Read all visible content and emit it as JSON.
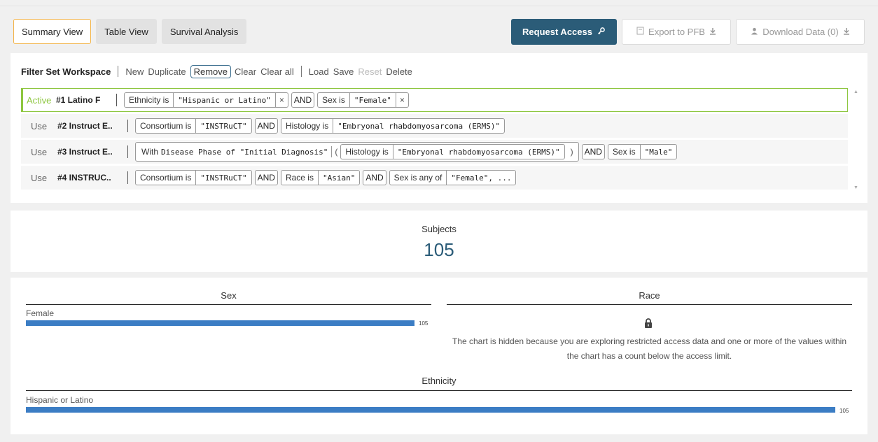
{
  "tabs": [
    {
      "label": "Summary View",
      "active": true
    },
    {
      "label": "Table View",
      "active": false
    },
    {
      "label": "Survival Analysis",
      "active": false
    }
  ],
  "actions": {
    "request_access": "Request Access",
    "export": "Export to PFB",
    "download": "Download Data (0)"
  },
  "workspace": {
    "title": "Filter Set Workspace",
    "links": [
      "New",
      "Duplicate",
      "Remove",
      "Clear",
      "Clear all",
      "Load",
      "Save",
      "Reset",
      "Delete"
    ],
    "filter_sets": [
      {
        "status": "Active",
        "name": "#1 Latino F"
      },
      {
        "status": "Use",
        "name": "#2 Instruct E.."
      },
      {
        "status": "Use",
        "name": "#3 Instruct E.."
      },
      {
        "status": "Use",
        "name": "#4 INSTRUC.."
      }
    ],
    "row1": {
      "f1_key": "Ethnicity is",
      "f1_val": "\"Hispanic or Latino\"",
      "and": "AND",
      "f2_key": "Sex is",
      "f2_val": "\"Female\"",
      "x": "×"
    },
    "row2": {
      "f1_key": "Consortium is",
      "f1_val": "\"INSTRuCT\"",
      "and": "AND",
      "f2_key": "Histology is",
      "f2_val": "\"Embryonal rhabdomyosarcoma (ERMS)\""
    },
    "row3": {
      "with": "With",
      "with_text": "Disease Phase of \"Initial Diagnosis\"",
      "open": "(",
      "close": ")",
      "f1_key": "Histology is",
      "f1_val": "\"Embryonal rhabdomyosarcoma (ERMS)\"",
      "and": "AND",
      "f2_key": "Sex is",
      "f2_val": "\"Male\""
    },
    "row4": {
      "f1_key": "Consortium is",
      "f1_val": "\"INSTRuCT\"",
      "and": "AND",
      "f2_key": "Race is",
      "f2_val": "\"Asian\"",
      "and2": "AND",
      "f3_key": "Sex is any of",
      "f3_val": "\"Female\", ..."
    }
  },
  "subjects": {
    "label": "Subjects",
    "count": "105"
  },
  "charts": {
    "sex": {
      "title": "Sex",
      "label": "Female",
      "value_label": "105"
    },
    "race": {
      "title": "Race",
      "message": "The chart is hidden because you are exploring restricted access data and one or more of the values within the chart has a count below the access limit."
    },
    "ethnicity": {
      "title": "Ethnicity",
      "label": "Hispanic or Latino",
      "value_label": "105"
    }
  },
  "chart_data": [
    {
      "type": "bar",
      "title": "Sex",
      "categories": [
        "Female"
      ],
      "values": [
        105
      ],
      "xlim": [
        0,
        105
      ]
    },
    {
      "type": "bar",
      "title": "Ethnicity",
      "categories": [
        "Hispanic or Latino"
      ],
      "values": [
        105
      ],
      "xlim": [
        0,
        105
      ]
    }
  ],
  "colors": {
    "accent": "#2b5c78",
    "bar": "#3b7dc4",
    "active_border": "#8dc63f",
    "tab_active_border": "#f2b347"
  },
  "icons": [
    "key-icon",
    "file-icon",
    "download-icon",
    "user-icon",
    "lock-icon",
    "close-icon",
    "chevron-up-icon",
    "chevron-down-icon"
  ]
}
